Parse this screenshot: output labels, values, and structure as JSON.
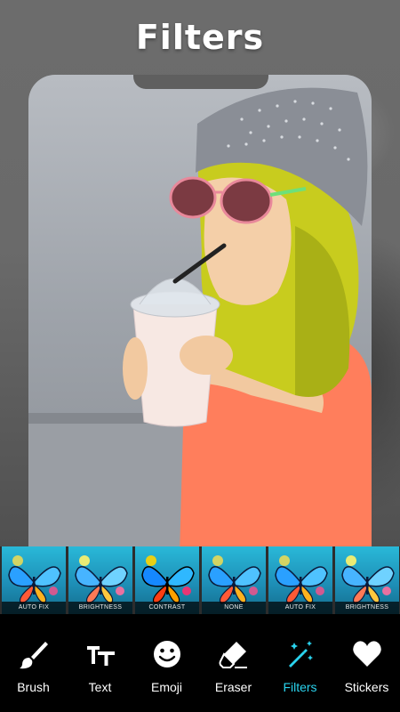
{
  "header": {
    "title": "Filters"
  },
  "colors": {
    "accent": "#2ad3ee",
    "toolbar_bg": "#000000",
    "icon": "#ffffff"
  },
  "filters": [
    {
      "label": "AUTO FIX"
    },
    {
      "label": "BRIGHTNESS"
    },
    {
      "label": "CONTRAST"
    },
    {
      "label": "NONE"
    },
    {
      "label": "AUTO FIX"
    },
    {
      "label": "BRIGHTNESS"
    }
  ],
  "toolbar": {
    "active": "Filters",
    "items": [
      {
        "label": "Brush",
        "icon": "brush-icon"
      },
      {
        "label": "Text",
        "icon": "text-icon"
      },
      {
        "label": "Emoji",
        "icon": "emoji-icon"
      },
      {
        "label": "Eraser",
        "icon": "eraser-icon"
      },
      {
        "label": "Filters",
        "icon": "magic-wand-icon"
      },
      {
        "label": "Stickers",
        "icon": "heart-icon"
      }
    ]
  }
}
